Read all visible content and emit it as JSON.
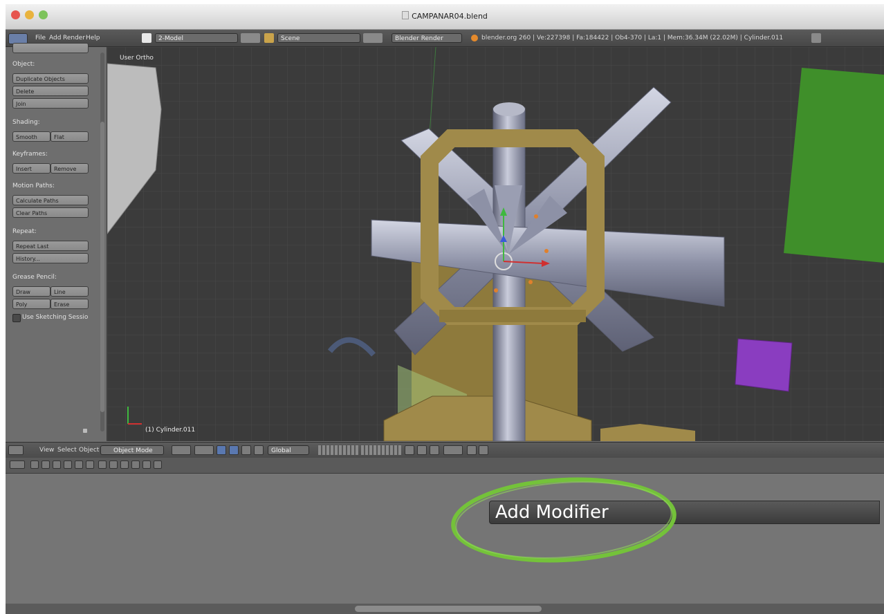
{
  "window": {
    "title": "CAMPANAR04.blend"
  },
  "info_header": {
    "menus": [
      "File",
      "Add",
      "Render",
      "Help"
    ],
    "layout": "2-Model",
    "scene": "Scene",
    "engine": "Blender Render",
    "stats": "blender.org 260 | Ve:227398 | Fa:184422 | Ob4-370 | La:1 | Mem:36.34M (22.02M) | Cylinder.011"
  },
  "tool_shelf": {
    "top_button": "",
    "object_title": "Object:",
    "duplicate_objects": "Duplicate Objects",
    "delete": "Delete",
    "join": "Join",
    "shading_title": "Shading:",
    "smooth": "Smooth",
    "flat": "Flat",
    "keyframes_title": "Keyframes:",
    "insert": "Insert",
    "remove": "Remove",
    "motion_paths_title": "Motion Paths:",
    "calculate_paths": "Calculate Paths",
    "clear_paths": "Clear Paths",
    "repeat_title": "Repeat:",
    "repeat_last": "Repeat Last",
    "history": "History...",
    "grease_pencil_title": "Grease Pencil:",
    "draw": "Draw",
    "line": "Line",
    "poly": "Poly",
    "erase": "Erase",
    "use_sketching": "Use Sketching Sessio"
  },
  "viewport": {
    "view_label": "User Ortho",
    "object_label": "(1) Cylinder.011"
  },
  "viewport_header": {
    "menus": [
      "View",
      "Select",
      "Object"
    ],
    "mode": "Object Mode",
    "orientation": "Global"
  },
  "properties": {
    "add_modifier": "Add Modifier"
  },
  "colors": {
    "annotation": "#74c23a",
    "tower": "#a08a4a",
    "cylinders": "#8d91a6",
    "green_plane": "#3f8f2a",
    "purple_box": "#8a3dc0"
  }
}
